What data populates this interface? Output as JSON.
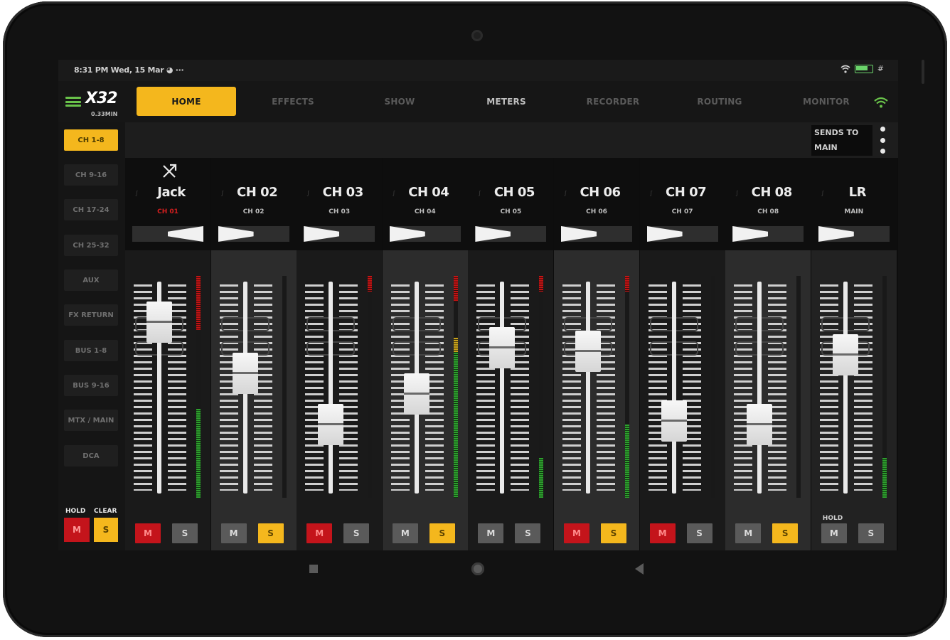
{
  "status": {
    "time": "8:31 PM",
    "date": "Wed, 15 Mar",
    "battery": "#"
  },
  "app": {
    "logo": "X32",
    "logo_sub": "0.33MIN"
  },
  "tabs": [
    {
      "label": "HOME",
      "active": true
    },
    {
      "label": "EFFECTS"
    },
    {
      "label": "SHOW"
    },
    {
      "label": "METERS"
    },
    {
      "label": "RECORDER"
    },
    {
      "label": "ROUTING"
    },
    {
      "label": "MONITOR"
    }
  ],
  "sidebar": {
    "items": [
      "CH 1-8",
      "CH 9-16",
      "CH 17-24",
      "CH 25-32",
      "AUX",
      "FX RETURN",
      "BUS 1-8",
      "BUS 9-16",
      "MTX / MAIN",
      "DCA"
    ],
    "hold_label": "HOLD",
    "clear_label": "CLEAR",
    "mute_label": "M",
    "solo_label": "S"
  },
  "sends_to": {
    "line1": "SENDS TO",
    "line2": "MAIN"
  },
  "channels": [
    {
      "name": "Jack",
      "sub": "CH 01",
      "level": 0.85,
      "meter": 0.4,
      "mute": true,
      "solo": false,
      "pan_side": "right"
    },
    {
      "name": "CH 02",
      "sub": "CH 02",
      "level": 0.55,
      "meter": 0.0,
      "mute": false,
      "solo": true,
      "pan_side": "left"
    },
    {
      "name": "CH 03",
      "sub": "CH 03",
      "level": 0.25,
      "meter": 0.0,
      "mute": true,
      "solo": false,
      "pan_side": "left"
    },
    {
      "name": "CH 04",
      "sub": "CH 04",
      "level": 0.43,
      "meter": 0.72,
      "mute": false,
      "solo": true,
      "pan_side": "left"
    },
    {
      "name": "CH 05",
      "sub": "CH 05",
      "level": 0.7,
      "meter": 0.18,
      "mute": false,
      "solo": false,
      "pan_side": "left"
    },
    {
      "name": "CH 06",
      "sub": "CH 06",
      "level": 0.68,
      "meter": 0.33,
      "mute": true,
      "solo": true,
      "pan_side": "left"
    },
    {
      "name": "CH 07",
      "sub": "CH 07",
      "level": 0.27,
      "meter": 0.0,
      "mute": true,
      "solo": false,
      "pan_side": "left"
    },
    {
      "name": "CH 08",
      "sub": "CH 08",
      "level": 0.25,
      "meter": 0.0,
      "mute": false,
      "solo": true,
      "pan_side": "left"
    },
    {
      "name": "LR",
      "sub": "MAIN",
      "level": 0.66,
      "meter": 0.18,
      "mute": false,
      "solo": false,
      "pan_side": "left"
    }
  ],
  "mute_label": "M",
  "solo_label": "S",
  "lr_hold_label": "HOLD",
  "colors": {
    "accent": "#f4b71d",
    "mute": "#c4141b",
    "green": "#69c24a"
  }
}
